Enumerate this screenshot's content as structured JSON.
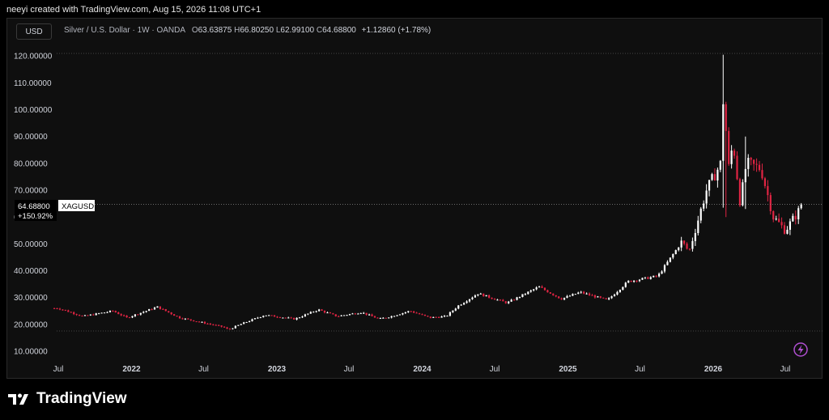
{
  "header": {
    "attribution": "neeyi created with TradingView.com, Aug 15, 2026 11:08 UTC+1"
  },
  "toolbar": {
    "currency_label": "USD"
  },
  "legend": {
    "symbol_desc": "Silver / U.S. Dollar · 1W · OANDA",
    "o_label": "O",
    "o_value": "63.63875",
    "h_label": "H",
    "h_value": "66.80250",
    "l_label": "L",
    "l_value": "62.99100",
    "c_label": "C",
    "c_value": "64.68800",
    "change": "+1.12860 (+1.78%)"
  },
  "price_tag": {
    "value": "64.68800",
    "percent": "+150.92%",
    "symbol": "XAGUSD"
  },
  "brand": {
    "name": "TradingView"
  },
  "icons": {
    "logo": "tradingview-logo-icon",
    "lightning": "lightning-icon"
  },
  "colors": {
    "background": "#0f0f0f",
    "up": "#ffffff",
    "down": "#e02443",
    "text": "#d1d4dc",
    "accent": "#9c27b0"
  },
  "chart_data": {
    "type": "candlestick",
    "title": "Silver / U.S. Dollar · 1W · OANDA",
    "symbol": "XAGUSD",
    "last_price": 64.688,
    "y_ticks": [
      "120.00000",
      "110.00000",
      "100.00000",
      "90.00000",
      "80.00000",
      "70.00000",
      "60.00000",
      "50.00000",
      "40.00000",
      "30.00000",
      "20.00000",
      "10.00000"
    ],
    "ylim": [
      7,
      124
    ],
    "x_ticks": [
      "Jul",
      "2022",
      "Jul",
      "2023",
      "Jul",
      "2024",
      "Jul",
      "2025",
      "Jul",
      "2026",
      "Jul"
    ],
    "grid": false,
    "price_path": [
      [
        "2021-07-01",
        26
      ],
      [
        "2021-09-01",
        23
      ],
      [
        "2021-11-15",
        25
      ],
      [
        "2021-12-20",
        22.5
      ],
      [
        "2022-03-07",
        26.5
      ],
      [
        "2022-05-01",
        22.5
      ],
      [
        "2022-08-20",
        19
      ],
      [
        "2022-09-01",
        18
      ],
      [
        "2022-10-01",
        20
      ],
      [
        "2022-12-01",
        23.5
      ],
      [
        "2023-02-15",
        22
      ],
      [
        "2023-04-15",
        25.5
      ],
      [
        "2023-06-01",
        23
      ],
      [
        "2023-08-01",
        24.5
      ],
      [
        "2023-09-15",
        22
      ],
      [
        "2023-10-15",
        23
      ],
      [
        "2023-12-01",
        25
      ],
      [
        "2024-01-20",
        22.5
      ],
      [
        "2024-03-01",
        23
      ],
      [
        "2024-04-01",
        27
      ],
      [
        "2024-05-20",
        31.5
      ],
      [
        "2024-08-01",
        28
      ],
      [
        "2024-10-20",
        34
      ],
      [
        "2024-12-15",
        29.5
      ],
      [
        "2025-02-01",
        32
      ],
      [
        "2025-04-10",
        29
      ],
      [
        "2025-06-01",
        36
      ],
      [
        "2025-08-15",
        38
      ],
      [
        "2025-10-15",
        51
      ],
      [
        "2025-11-01",
        47
      ],
      [
        "2025-12-15",
        70
      ],
      [
        "2026-01-20",
        80
      ],
      [
        "2026-01-29",
        115
      ],
      [
        "2026-02-05",
        75
      ],
      [
        "2026-02-20",
        88
      ],
      [
        "2026-03-10",
        65
      ],
      [
        "2026-03-25",
        80
      ],
      [
        "2026-05-01",
        78
      ],
      [
        "2026-06-01",
        60
      ],
      [
        "2026-07-01",
        55
      ],
      [
        "2026-08-15",
        64.688
      ]
    ],
    "wick_spikes": [
      [
        "2026-01-29",
        120.5,
        63.5
      ],
      [
        "2026-02-05",
        98,
        60
      ],
      [
        "2026-03-20",
        90,
        63
      ]
    ]
  }
}
